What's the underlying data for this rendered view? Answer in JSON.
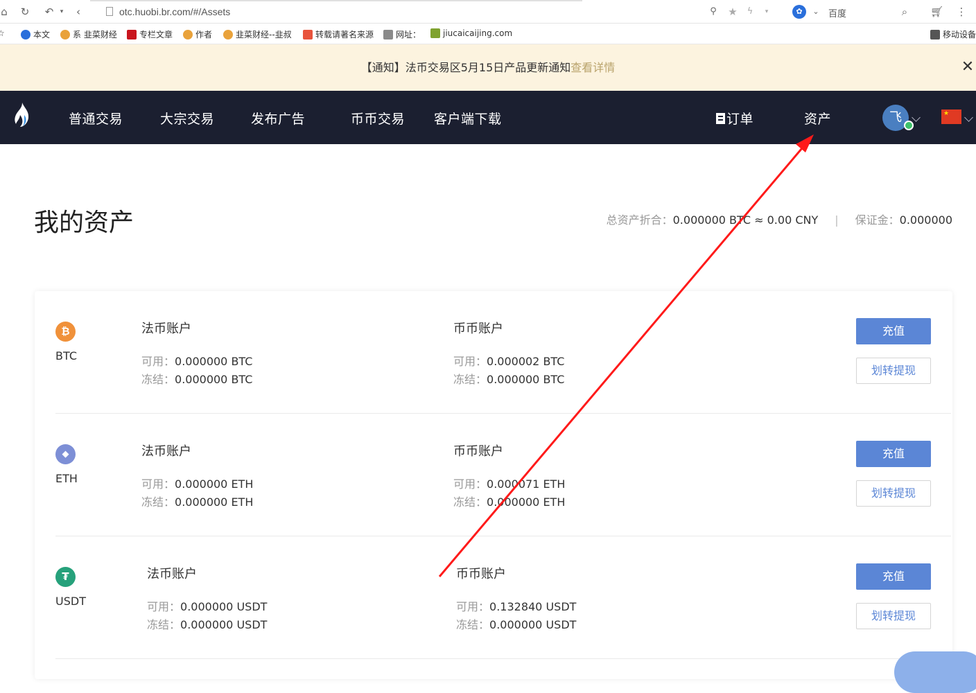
{
  "browser": {
    "url": "otc.huobi.br.com/#/Assets",
    "search_engine": "百度"
  },
  "bookmarks": [
    {
      "label": "本文",
      "color": "#2a6fdb"
    },
    {
      "label": "系 韭菜财经",
      "color": "#e9a23b"
    },
    {
      "label": "专栏文章",
      "color": "#c9151e"
    },
    {
      "label": "作者",
      "color": "#e9a23b"
    },
    {
      "label": "韭菜财经--韭叔",
      "color": "#e9a23b"
    },
    {
      "label": "转载请著名来源",
      "color": "#e8533c"
    },
    {
      "label": "网址：",
      "color": "#8a8a8a"
    },
    {
      "label": "jiucaicaijing.com",
      "color": "#7fa22f"
    },
    {
      "label": "移动设备",
      "color": "#555555"
    }
  ],
  "notice": {
    "text": "【通知】法币交易区5月15日产品更新通知",
    "link": "查看详情"
  },
  "nav": {
    "items": [
      "普通交易",
      "大宗交易",
      "发布广告",
      "币币交易",
      "客户端下载"
    ],
    "orders": "订单",
    "assets": "资产",
    "avatar": "飞"
  },
  "page": {
    "title": "我的资产",
    "total_label": "总资产折合：",
    "total_value": "0.000000 BTC ≈ 0.00 CNY",
    "separator": "|",
    "margin_label": "保证金：",
    "margin_value": "0.000000"
  },
  "assets": [
    {
      "coin": "BTC",
      "icon_color": "#f0913a",
      "icon_glyph": "₿",
      "fiat": {
        "title": "法币账户",
        "avail_label": "可用：",
        "avail": "0.000000 BTC",
        "frozen_label": "冻结：",
        "frozen": "0.000000 BTC"
      },
      "coin_acct": {
        "title": "币币账户",
        "avail_label": "可用：",
        "avail": "0.000002 BTC",
        "frozen_label": "冻结：",
        "frozen": "0.000000 BTC"
      },
      "deposit": "充值",
      "transfer": "划转提现"
    },
    {
      "coin": "ETH",
      "icon_color": "#7d8fd6",
      "icon_glyph": "◆",
      "fiat": {
        "title": "法币账户",
        "avail_label": "可用：",
        "avail": "0.000000 ETH",
        "frozen_label": "冻结：",
        "frozen": "0.000000 ETH"
      },
      "coin_acct": {
        "title": "币币账户",
        "avail_label": "可用：",
        "avail": "0.000071 ETH",
        "frozen_label": "冻结：",
        "frozen": "0.000000 ETH"
      },
      "deposit": "充值",
      "transfer": "划转提现"
    },
    {
      "coin": "USDT",
      "icon_color": "#26a17b",
      "icon_glyph": "₮",
      "fiat": {
        "title": "法币账户",
        "avail_label": "可用：",
        "avail": "0.000000 USDT",
        "frozen_label": "冻结：",
        "frozen": "0.000000 USDT"
      },
      "coin_acct": {
        "title": "币币账户",
        "avail_label": "可用：",
        "avail": "0.132840 USDT",
        "frozen_label": "冻结：",
        "frozen": "0.000000 USDT"
      },
      "deposit": "充值",
      "transfer": "划转提现"
    }
  ],
  "annotation_color": "#ff1a1a"
}
